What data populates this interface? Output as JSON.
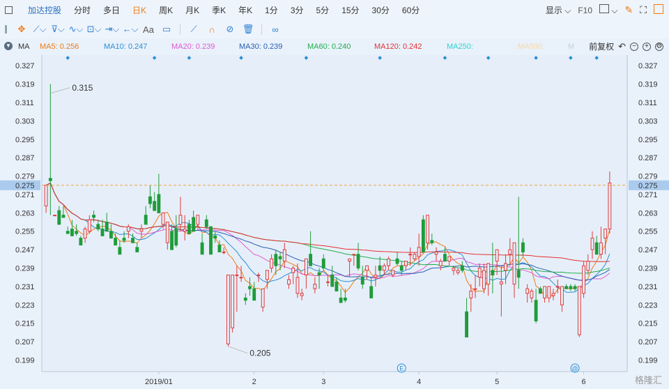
{
  "tabbar": {
    "title": "加达控股",
    "tabs": [
      "分时",
      "多日",
      "日K",
      "周K",
      "月K",
      "季K",
      "年K",
      "1分",
      "3分",
      "5分",
      "15分",
      "30分",
      "60分"
    ],
    "active_tab": "日K",
    "display_label": "显示",
    "f10_label": "F10"
  },
  "toolbar": {
    "text_tool": "Aa"
  },
  "ma_bar": {
    "label": "MA",
    "items": [
      {
        "text": "MA5: 0.256",
        "color": "#f07c14"
      },
      {
        "text": "MA10: 0.247",
        "color": "#2a8fd2"
      },
      {
        "text": "MA20: 0.239",
        "color": "#e05ad0"
      },
      {
        "text": "MA30: 0.239",
        "color": "#2a5fb0"
      },
      {
        "text": "MA60: 0.240",
        "color": "#1fae4c"
      },
      {
        "text": "MA120: 0.242",
        "color": "#e53030"
      },
      {
        "text": "MA250:",
        "color": "#2ad6d0"
      },
      {
        "text": "MA500:",
        "color": "#f5d9a8"
      },
      {
        "text": "M",
        "color": "#c0d0e0"
      }
    ],
    "adjust_label": "前复权"
  },
  "watermark": "格隆汇",
  "chart_data": {
    "type": "candlestick",
    "y_ticks": [
      "0.327",
      "0.319",
      "0.311",
      "0.303",
      "0.295",
      "0.287",
      "0.279",
      "0.271",
      "0.263",
      "0.255",
      "0.247",
      "0.239",
      "0.231",
      "0.223",
      "0.215",
      "0.207",
      "0.199"
    ],
    "ylim": [
      0.194,
      0.331
    ],
    "x_ticks": [
      {
        "label": "2019/01",
        "i": 26
      },
      {
        "label": "2",
        "i": 48
      },
      {
        "label": "3",
        "i": 64
      },
      {
        "label": "4",
        "i": 86
      },
      {
        "label": "5",
        "i": 104
      },
      {
        "label": "6",
        "i": 124
      }
    ],
    "current_price": "0.275",
    "annotations": [
      {
        "label": "0.315",
        "i": 1,
        "price": 0.315
      },
      {
        "label": "0.205",
        "i": 42,
        "price": 0.205
      }
    ],
    "event_markers": [
      {
        "label": "E",
        "i": 82
      },
      {
        "label": "@",
        "i": 122
      }
    ],
    "candles": [
      [
        0.266,
        0.271,
        0.263,
        0.275
      ],
      [
        0.278,
        0.319,
        0.262,
        0.277
      ],
      [
        0.262,
        0.262,
        0.262,
        0.262
      ],
      [
        0.264,
        0.266,
        0.262,
        0.258
      ],
      [
        0.262,
        0.266,
        0.261,
        0.261
      ],
      [
        0.255,
        0.257,
        0.254,
        0.254
      ],
      [
        0.256,
        0.26,
        0.254,
        0.253
      ],
      [
        0.255,
        0.258,
        0.253,
        0.254
      ],
      [
        0.252,
        0.253,
        0.249,
        0.249
      ],
      [
        0.252,
        0.257,
        0.25,
        0.256
      ],
      [
        0.255,
        0.262,
        0.254,
        0.26
      ],
      [
        0.262,
        0.264,
        0.259,
        0.261
      ],
      [
        0.258,
        0.26,
        0.255,
        0.256
      ],
      [
        0.256,
        0.26,
        0.254,
        0.253
      ],
      [
        0.259,
        0.263,
        0.256,
        0.255
      ],
      [
        0.255,
        0.258,
        0.252,
        0.252
      ],
      [
        0.252,
        0.254,
        0.249,
        0.249
      ],
      [
        0.248,
        0.251,
        0.247,
        0.245
      ],
      [
        0.252,
        0.255,
        0.25,
        0.251
      ],
      [
        0.255,
        0.258,
        0.252,
        0.257
      ],
      [
        0.252,
        0.254,
        0.25,
        0.25
      ],
      [
        0.248,
        0.25,
        0.246,
        0.246
      ],
      [
        0.255,
        0.258,
        0.252,
        0.256
      ],
      [
        0.262,
        0.266,
        0.258,
        0.258
      ],
      [
        0.27,
        0.275,
        0.265,
        0.267
      ],
      [
        0.268,
        0.272,
        0.266,
        0.264
      ],
      [
        0.271,
        0.28,
        0.263,
        0.263
      ],
      [
        0.258,
        0.262,
        0.256,
        0.263
      ],
      [
        0.25,
        0.258,
        0.247,
        0.259
      ],
      [
        0.255,
        0.258,
        0.247,
        0.247
      ],
      [
        0.256,
        0.262,
        0.248,
        0.249
      ],
      [
        0.258,
        0.27,
        0.255,
        0.262
      ],
      [
        0.255,
        0.262,
        0.251,
        0.256
      ],
      [
        0.258,
        0.26,
        0.254,
        0.254
      ],
      [
        0.261,
        0.264,
        0.255,
        0.255
      ],
      [
        0.258,
        0.262,
        0.256,
        0.262
      ],
      [
        0.25,
        0.254,
        0.246,
        0.245
      ],
      [
        0.26,
        0.262,
        0.256,
        0.257
      ],
      [
        0.257,
        0.257,
        0.245,
        0.245
      ],
      [
        0.253,
        0.255,
        0.25,
        0.252
      ],
      [
        0.249,
        0.251,
        0.246,
        0.246
      ],
      [
        0.246,
        0.248,
        0.245,
        0.246
      ],
      [
        0.206,
        0.236,
        0.205,
        0.236
      ],
      [
        0.213,
        0.236,
        0.211,
        0.236
      ],
      [
        0.236,
        0.24,
        0.22,
        0.236
      ],
      [
        0.235,
        0.24,
        0.233,
        0.235
      ],
      [
        0.226,
        0.228,
        0.223,
        0.225
      ],
      [
        0.231,
        0.235,
        0.227,
        0.23
      ],
      [
        0.23,
        0.233,
        0.226,
        0.225
      ],
      [
        0.236,
        0.237,
        0.233,
        0.236
      ],
      [
        0.222,
        0.228,
        0.22,
        0.23
      ],
      [
        0.234,
        0.236,
        0.23,
        0.238
      ],
      [
        0.239,
        0.245,
        0.237,
        0.243
      ],
      [
        0.245,
        0.247,
        0.236,
        0.24
      ],
      [
        0.244,
        0.246,
        0.238,
        0.243
      ],
      [
        0.242,
        0.25,
        0.239,
        0.247
      ],
      [
        0.232,
        0.236,
        0.23,
        0.234
      ],
      [
        0.237,
        0.24,
        0.232,
        0.239
      ],
      [
        0.228,
        0.241,
        0.226,
        0.235
      ],
      [
        0.227,
        0.23,
        0.225,
        0.228
      ],
      [
        0.236,
        0.242,
        0.23,
        0.243
      ],
      [
        0.245,
        0.255,
        0.241,
        0.24
      ],
      [
        0.23,
        0.235,
        0.228,
        0.232
      ],
      [
        0.237,
        0.239,
        0.23,
        0.236
      ],
      [
        0.243,
        0.245,
        0.238,
        0.239
      ],
      [
        0.233,
        0.236,
        0.231,
        0.233
      ],
      [
        0.236,
        0.24,
        0.234,
        0.231
      ],
      [
        0.233,
        0.235,
        0.23,
        0.229
      ],
      [
        0.226,
        0.23,
        0.225,
        0.224
      ],
      [
        0.226,
        0.23,
        0.224,
        0.225
      ],
      [
        0.242,
        0.243,
        0.235,
        0.243
      ],
      [
        0.245,
        0.245,
        0.24,
        0.245
      ],
      [
        0.245,
        0.25,
        0.238,
        0.239
      ],
      [
        0.235,
        0.24,
        0.23,
        0.232
      ],
      [
        0.238,
        0.24,
        0.234,
        0.24
      ],
      [
        0.231,
        0.235,
        0.226,
        0.226
      ],
      [
        0.235,
        0.24,
        0.231,
        0.236
      ],
      [
        0.24,
        0.244,
        0.235,
        0.238
      ],
      [
        0.238,
        0.241,
        0.236,
        0.24
      ],
      [
        0.24,
        0.244,
        0.238,
        0.243
      ],
      [
        0.236,
        0.238,
        0.235,
        0.238
      ],
      [
        0.243,
        0.246,
        0.24,
        0.241
      ],
      [
        0.24,
        0.242,
        0.236,
        0.238
      ],
      [
        0.24,
        0.242,
        0.238,
        0.242
      ],
      [
        0.245,
        0.248,
        0.24,
        0.245
      ],
      [
        0.243,
        0.246,
        0.242,
        0.245
      ],
      [
        0.244,
        0.254,
        0.24,
        0.248
      ],
      [
        0.26,
        0.262,
        0.246,
        0.246
      ],
      [
        0.25,
        0.262,
        0.247,
        0.262
      ],
      [
        0.251,
        0.254,
        0.249,
        0.25
      ],
      [
        0.245,
        0.248,
        0.242,
        0.246
      ],
      [
        0.24,
        0.243,
        0.238,
        0.242
      ],
      [
        0.245,
        0.248,
        0.242,
        0.242
      ],
      [
        0.242,
        0.244,
        0.24,
        0.244
      ],
      [
        0.238,
        0.24,
        0.236,
        0.239
      ],
      [
        0.237,
        0.239,
        0.236,
        0.238
      ],
      [
        0.24,
        0.242,
        0.237,
        0.238
      ],
      [
        0.22,
        0.226,
        0.21,
        0.209
      ],
      [
        0.226,
        0.232,
        0.22,
        0.229
      ],
      [
        0.23,
        0.236,
        0.226,
        0.23
      ],
      [
        0.235,
        0.241,
        0.231,
        0.239
      ],
      [
        0.23,
        0.241,
        0.228,
        0.238
      ],
      [
        0.232,
        0.24,
        0.227,
        0.241
      ],
      [
        0.238,
        0.25,
        0.228,
        0.236
      ],
      [
        0.242,
        0.245,
        0.236,
        0.247
      ],
      [
        0.232,
        0.24,
        0.218,
        0.233
      ],
      [
        0.238,
        0.245,
        0.232,
        0.241
      ],
      [
        0.245,
        0.252,
        0.24,
        0.247
      ],
      [
        0.232,
        0.25,
        0.226,
        0.25
      ],
      [
        0.238,
        0.27,
        0.23,
        0.235
      ],
      [
        0.25,
        0.252,
        0.244,
        0.246
      ],
      [
        0.228,
        0.232,
        0.224,
        0.23
      ],
      [
        0.226,
        0.23,
        0.224,
        0.229
      ],
      [
        0.225,
        0.23,
        0.215,
        0.216
      ],
      [
        0.23,
        0.231,
        0.228,
        0.228
      ],
      [
        0.226,
        0.231,
        0.224,
        0.231
      ],
      [
        0.226,
        0.231,
        0.224,
        0.231
      ],
      [
        0.227,
        0.23,
        0.225,
        0.228
      ],
      [
        0.231,
        0.234,
        0.228,
        0.231
      ],
      [
        0.223,
        0.231,
        0.22,
        0.231
      ],
      [
        0.231,
        0.232,
        0.23,
        0.23
      ],
      [
        0.231,
        0.232,
        0.229,
        0.23
      ],
      [
        0.231,
        0.232,
        0.229,
        0.23
      ],
      [
        0.21,
        0.231,
        0.209,
        0.231
      ],
      [
        0.228,
        0.242,
        0.226,
        0.24
      ],
      [
        0.238,
        0.245,
        0.236,
        0.242
      ],
      [
        0.247,
        0.255,
        0.243,
        0.252
      ],
      [
        0.25,
        0.253,
        0.245,
        0.245
      ],
      [
        0.245,
        0.257,
        0.243,
        0.25
      ],
      [
        0.252,
        0.256,
        0.245,
        0.256
      ],
      [
        0.256,
        0.281,
        0.254,
        0.276
      ]
    ]
  }
}
